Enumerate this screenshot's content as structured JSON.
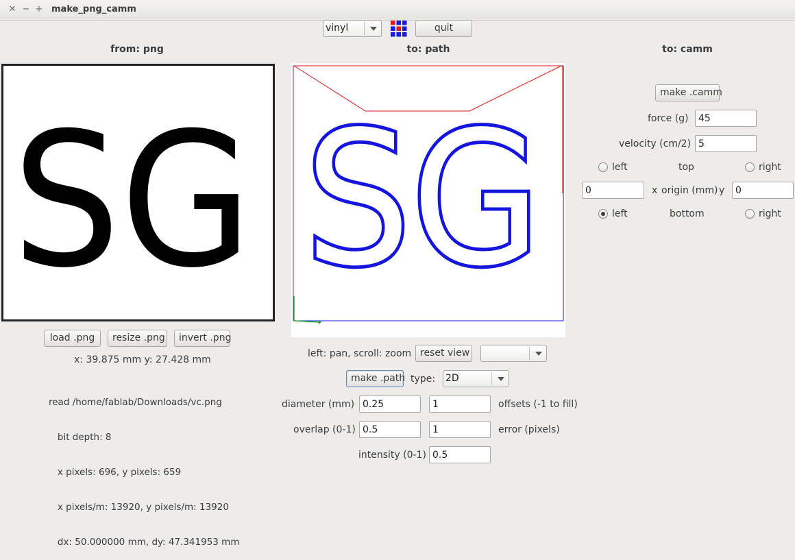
{
  "window": {
    "title": "make_png_camm"
  },
  "toolbar": {
    "machine_value": "vinyl",
    "quit_label": "quit",
    "brand_colors": [
      "#1a1adf",
      "#e01b1b"
    ]
  },
  "panels": {
    "png_header": "from: png",
    "path_header": "to: path",
    "camm_header": "to: camm"
  },
  "png": {
    "text": "SG",
    "load_label": "load .png",
    "resize_label": "resize .png",
    "invert_label": "invert .png",
    "coords": "x: 39.875 mm  y: 27.428 mm",
    "info": [
      "read /home/fablab/Downloads/vc.png",
      "   bit depth: 8",
      "   x pixels: 696, y pixels: 659",
      "   x pixels/m: 13920, y pixels/m: 13920",
      "   dx: 50.000000 mm, dy: 47.341953 mm"
    ]
  },
  "path": {
    "text": "SG",
    "hint": "left: pan, scroll: zoom",
    "reset_label": "reset view",
    "view_value": "",
    "make_label": "make .path",
    "type_label": "type:",
    "type_value": "2D",
    "diameter_label": "diameter (mm)",
    "diameter_value": "0.25",
    "offsets_value": "1",
    "offsets_label": "offsets (-1 to fill)",
    "overlap_label": "overlap (0-1)",
    "overlap_value": "0.5",
    "error_value": "1",
    "error_label": "error (pixels)",
    "intensity_label": "intensity (0-1)",
    "intensity_value": "0.5",
    "colors": {
      "toolpath": "#1515e0",
      "move": "#e01515",
      "axis": "#22aa22"
    }
  },
  "camm": {
    "make_label": "make .camm",
    "force_label": "force (g)",
    "force_value": "45",
    "velocity_label": "velocity (cm/2)",
    "velocity_value": "5",
    "left_label": "left",
    "top_label": "top",
    "right_label": "right",
    "origin_x_value": "0",
    "origin_x_label": "x",
    "origin_label": "origin (mm)",
    "origin_y_label": "y",
    "origin_y_value": "0",
    "bottom_left_label": "left",
    "bottom_label": "bottom",
    "bottom_right_label": "right"
  }
}
